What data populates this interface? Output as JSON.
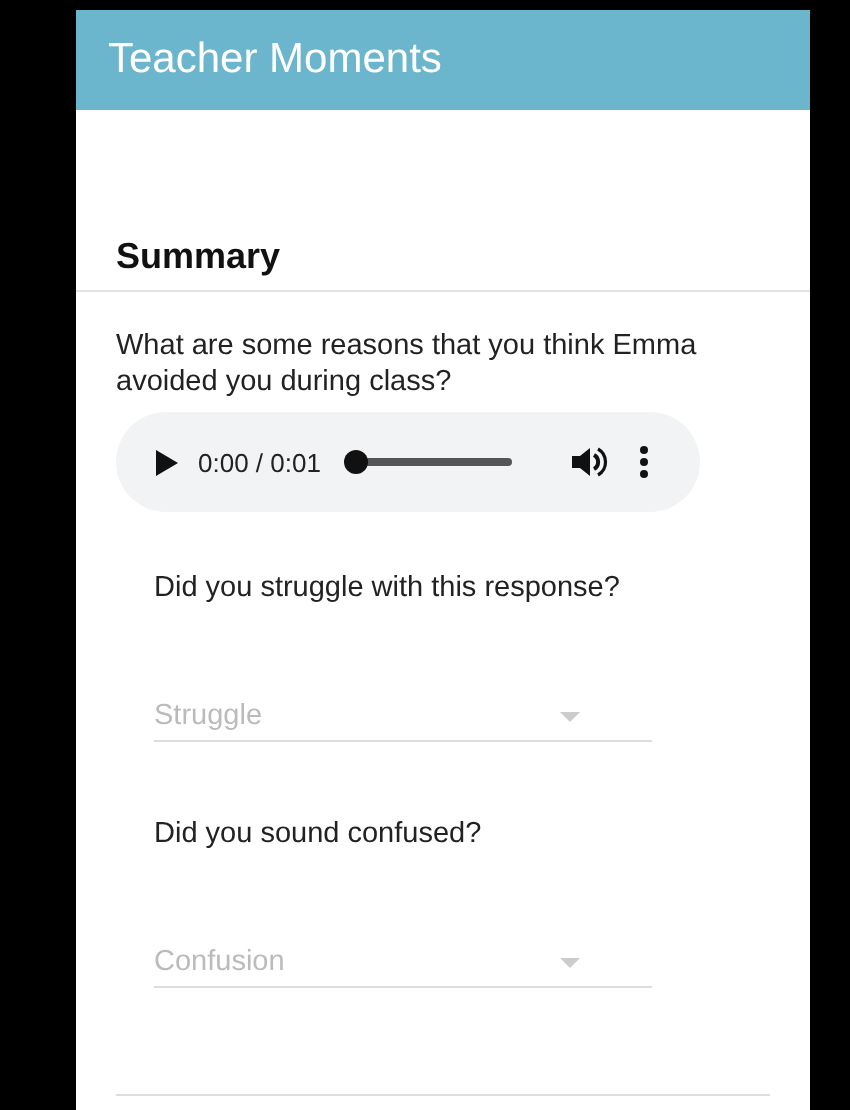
{
  "header": {
    "title": "Teacher Moments"
  },
  "section": {
    "title": "Summary"
  },
  "prompt": "What are some reasons that you think Emma avoided you during class?",
  "audio": {
    "time": "0:00 / 0:01",
    "level": 0
  },
  "questions": [
    {
      "label": "Did you struggle with this response?",
      "select": {
        "placeholder": "Struggle"
      }
    },
    {
      "label": "Did you sound confused?",
      "select": {
        "placeholder": "Confusion"
      }
    }
  ]
}
